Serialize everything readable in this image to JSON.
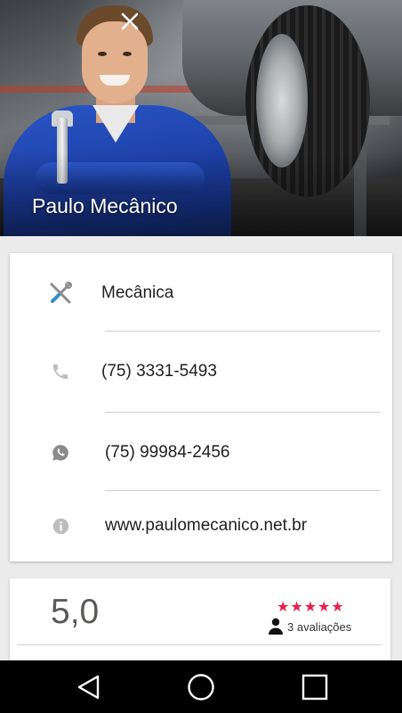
{
  "header": {
    "title": "Paulo Mecânico",
    "close_icon": "close-icon"
  },
  "info": {
    "category": {
      "icon": "tools-icon",
      "text": "Mecânica"
    },
    "phone": {
      "icon": "phone-icon",
      "text": "(75) 3331-5493"
    },
    "whatsapp": {
      "icon": "whatsapp-icon",
      "text": "(75) 99984-2456"
    },
    "website": {
      "icon": "info-icon",
      "text": "www.paulomecanico.net.br"
    }
  },
  "rating": {
    "value": "5,0",
    "stars": "★★★★★",
    "stars_count": 5,
    "reviews_label": "3 avaliações",
    "star_color": "#e8204a"
  },
  "navbar": {
    "back_icon": "back-triangle-icon",
    "home_icon": "home-circle-icon",
    "recents_icon": "recents-square-icon"
  }
}
